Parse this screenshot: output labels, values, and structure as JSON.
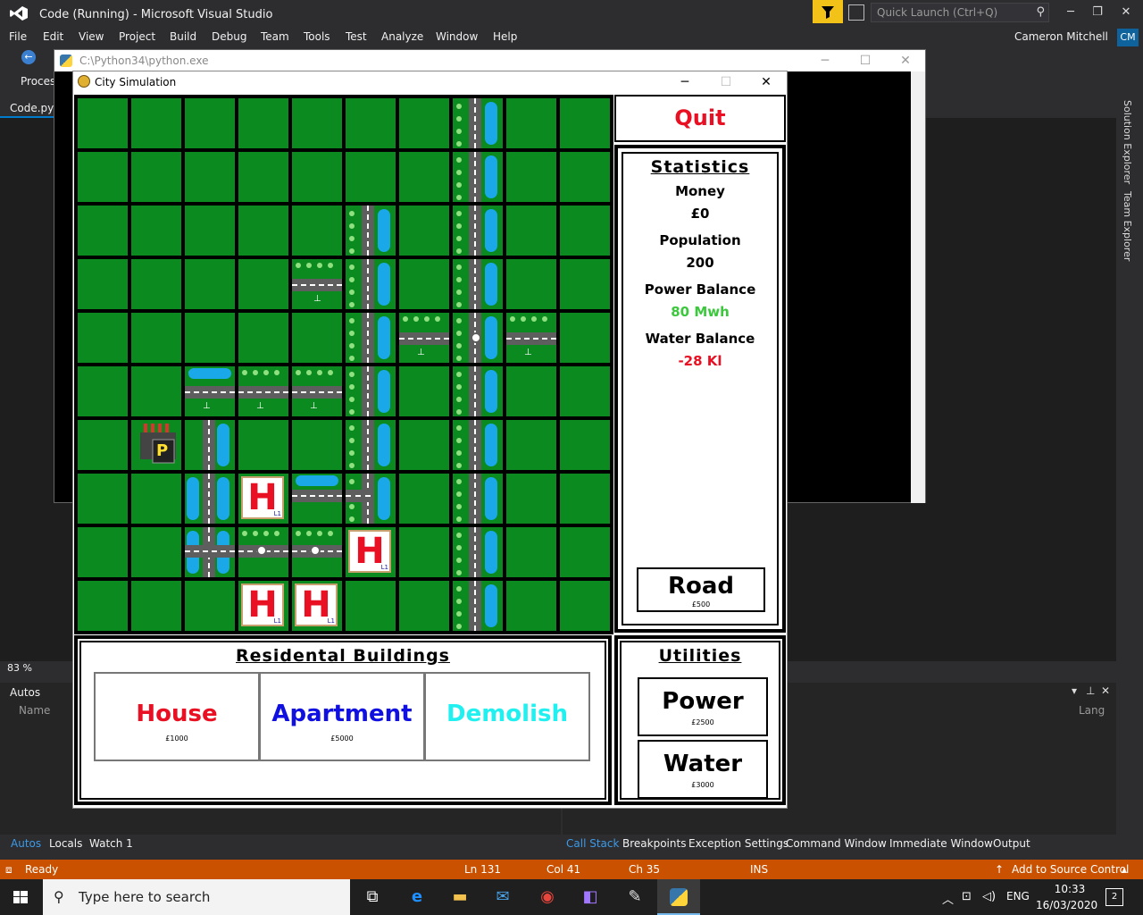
{
  "vs": {
    "window_title": "Code (Running) - Microsoft Visual Studio",
    "quick_launch": "Quick Launch (Ctrl+Q)",
    "user": "Cameron Mitchell",
    "avatar": "CM",
    "menu": [
      "File",
      "Edit",
      "View",
      "Project",
      "Build",
      "Debug",
      "Team",
      "Tools",
      "Test",
      "Analyze",
      "Window",
      "Help"
    ],
    "process_label": "Process",
    "code_tab": "Code.py",
    "zoom": "83 %",
    "side_tabs": [
      "Solution Explorer",
      "Team Explorer"
    ],
    "autos_title": "Autos",
    "autos_col_name": "Name",
    "lang_col": "Lang",
    "bottom_tabs_left": [
      "Autos",
      "Locals",
      "Watch 1"
    ],
    "bottom_tabs_right": [
      "Call Stack",
      "Breakpoints",
      "Exception Settings",
      "Command Window",
      "Immediate Window",
      "Output"
    ],
    "status": {
      "ready": "Ready",
      "line": "Ln 131",
      "col": "Col 41",
      "ch": "Ch 35",
      "ins": "INS",
      "source_control": "Add to Source Control"
    }
  },
  "console": {
    "title": "C:\\Python34\\python.exe"
  },
  "city": {
    "title": "City Simulation",
    "quit": "Quit",
    "stats": {
      "title": "Statistics",
      "money_label": "Money",
      "money_value": "£0",
      "population_label": "Population",
      "population_value": "200",
      "power_label": "Power Balance",
      "power_value": "80 Mwh",
      "water_label": "Water Balance",
      "water_value": "-28 Kl",
      "power_color": "#3cc83c",
      "water_color": "#e81022"
    },
    "road": {
      "label": "Road",
      "price": "£500"
    },
    "residential": {
      "title": "Residental Buildings",
      "buttons": [
        {
          "label": "House",
          "price": "£1000",
          "color": "#e81022"
        },
        {
          "label": "Apartment",
          "price": "£5000",
          "color": "#1010e0"
        },
        {
          "label": "Demolish",
          "price": "",
          "color": "#20f0f0"
        }
      ]
    },
    "utilities": {
      "title": "Utilities",
      "buttons": [
        {
          "label": "Power",
          "price": "£2500"
        },
        {
          "label": "Water",
          "price": "£3000"
        }
      ]
    },
    "map": {
      "grass_color": "#0a8a1f",
      "houses": [
        {
          "letter": "H",
          "level": "L1"
        },
        {
          "letter": "H",
          "level": "L1"
        },
        {
          "letter": "H",
          "level": "L1"
        },
        {
          "letter": "H",
          "level": "L1"
        }
      ],
      "power_plant_letter": "P"
    }
  },
  "taskbar": {
    "search_placeholder": "Type here to search",
    "lang": "ENG",
    "time": "10:33",
    "date": "16/03/2020",
    "notifications": "2"
  }
}
